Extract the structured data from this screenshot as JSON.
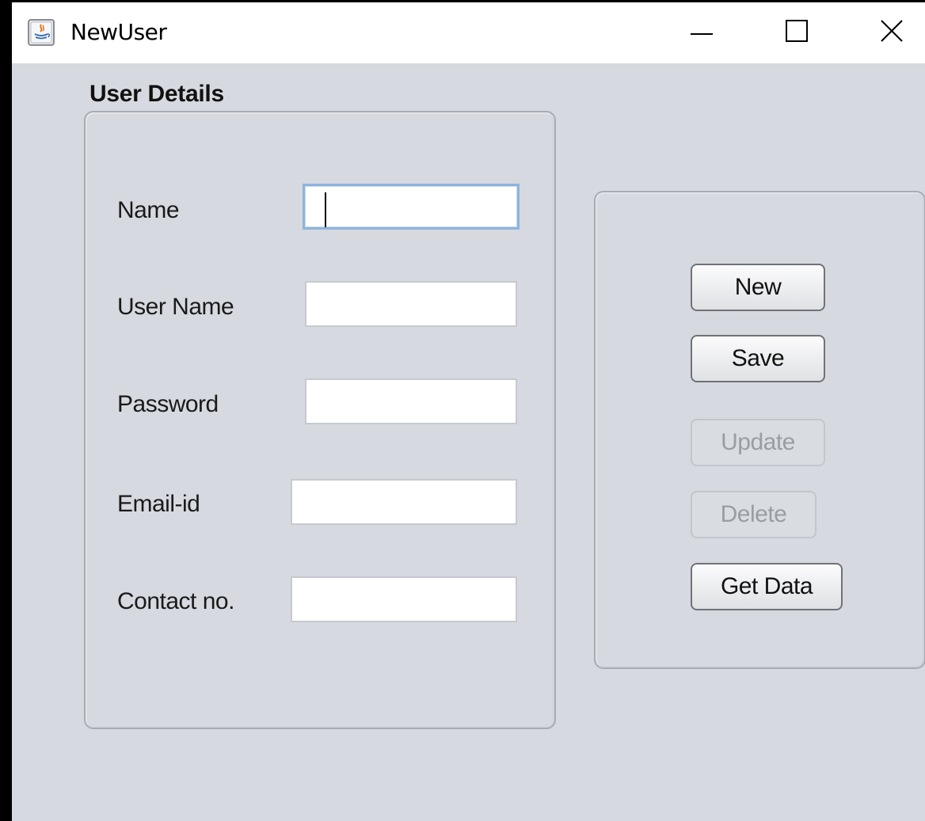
{
  "window": {
    "title": "NewUser",
    "icon": "java-icon",
    "controls": {
      "minimize": "minimize-icon",
      "maximize": "maximize-icon",
      "close": "close-icon"
    }
  },
  "form": {
    "section_title": "User Details",
    "fields": [
      {
        "label": "Name",
        "value": "",
        "focused": true
      },
      {
        "label": "User Name",
        "value": ""
      },
      {
        "label": "Password",
        "value": ""
      },
      {
        "label": "Email-id",
        "value": ""
      },
      {
        "label": "Contact no.",
        "value": ""
      }
    ]
  },
  "actions": {
    "new_label": "New",
    "save_label": "Save",
    "update_label": "Update",
    "delete_label": "Delete",
    "get_data_label": "Get Data",
    "update_enabled": false,
    "delete_enabled": false
  },
  "colors": {
    "window_background": "#d6d9df",
    "titlebar_background": "#ffffff",
    "focus_border": "#8fb3dc",
    "disabled_text": "#9a9da3"
  }
}
